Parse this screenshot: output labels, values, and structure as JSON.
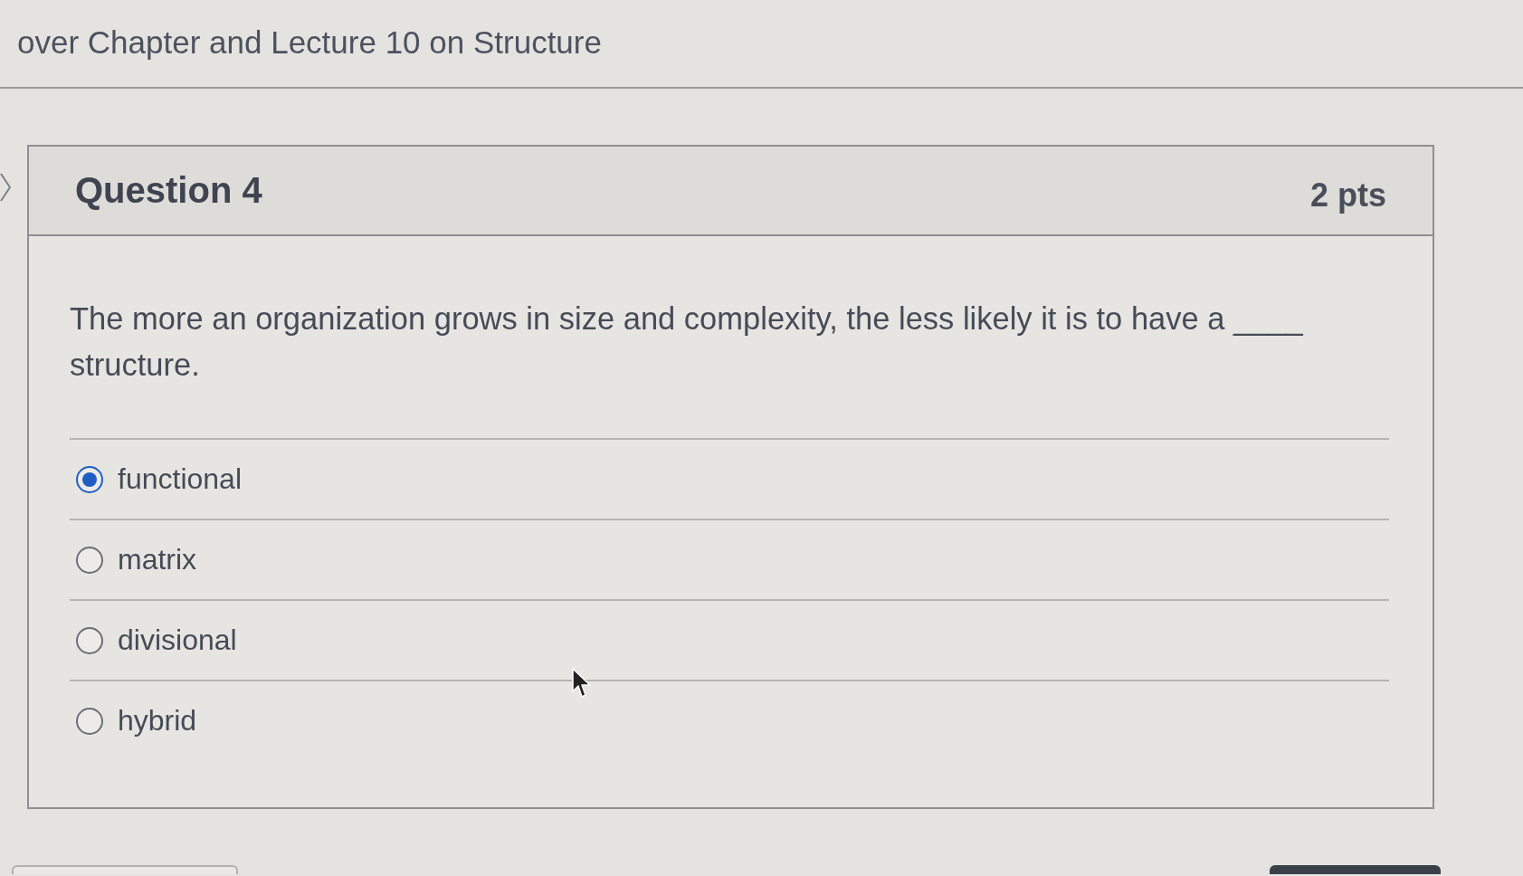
{
  "page": {
    "title": "over Chapter and Lecture 10 on Structure"
  },
  "question": {
    "title": "Question 4",
    "points": "2 pts",
    "text": "The more an organization grows in size and complexity, the less likely it is to have a ____ structure.",
    "answers": [
      {
        "label": "functional",
        "selected": true
      },
      {
        "label": "matrix",
        "selected": false
      },
      {
        "label": "divisional",
        "selected": false
      },
      {
        "label": "hybrid",
        "selected": false
      }
    ]
  }
}
